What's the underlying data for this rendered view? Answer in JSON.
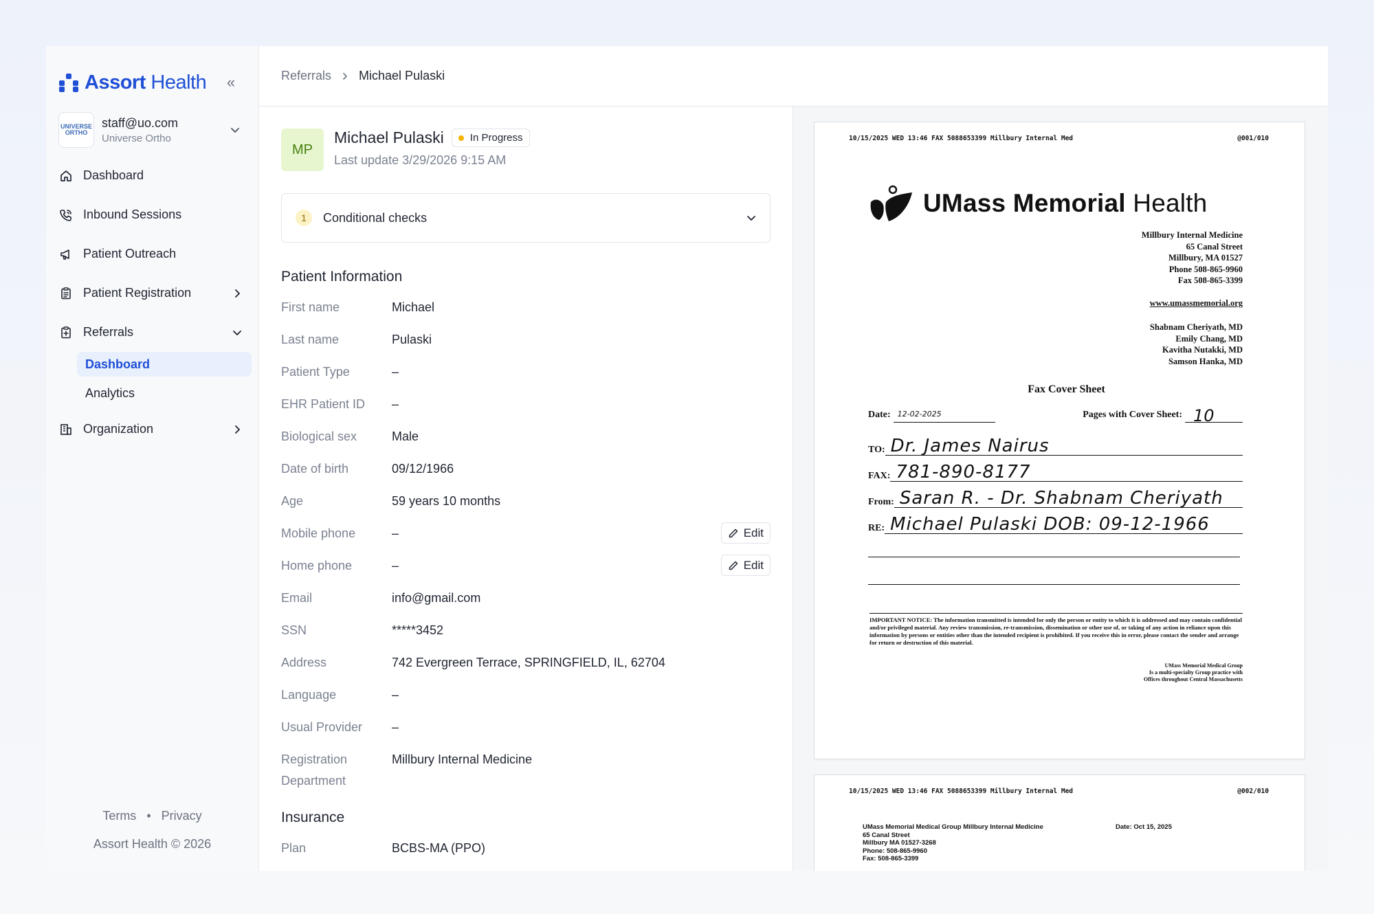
{
  "sidebar": {
    "brand_bold": "Assort",
    "brand_light": " Health",
    "collapse_glyph": "«",
    "account": {
      "logo_text": "UNIVERSE ORTHO",
      "email": "staff@uo.com",
      "org": "Universe Ortho"
    },
    "nav": [
      {
        "label": "Dashboard",
        "icon": "home-icon"
      },
      {
        "label": "Inbound Sessions",
        "icon": "phone-icon"
      },
      {
        "label": "Patient Outreach",
        "icon": "megaphone-icon"
      },
      {
        "label": "Patient Registration",
        "icon": "clipboard-icon"
      },
      {
        "label": "Referrals",
        "icon": "clipboard-plus-icon"
      },
      {
        "label": "Organization",
        "icon": "building-icon"
      }
    ],
    "referrals_sub": [
      {
        "label": "Dashboard",
        "active": true
      },
      {
        "label": "Analytics",
        "active": false
      }
    ],
    "footer": {
      "terms": "Terms",
      "dot": "•",
      "privacy": "Privacy",
      "copyright": "Assort Health © 2026"
    }
  },
  "breadcrumb": {
    "parent": "Referrals",
    "separator": "›",
    "current": "Michael Pulaski"
  },
  "patient": {
    "initials": "MP",
    "name": "Michael Pulaski",
    "status": "In Progress",
    "status_color": "#f4b400",
    "last_update": "Last update 3/29/2026 9:15 AM"
  },
  "conditional_checks": {
    "count": "1",
    "label": "Conditional checks"
  },
  "patient_info": {
    "title": "Patient Information",
    "fields": [
      {
        "label": "First name",
        "value": "Michael"
      },
      {
        "label": "Last name",
        "value": "Pulaski"
      },
      {
        "label": "Patient Type",
        "value": "–"
      },
      {
        "label": "EHR Patient ID",
        "value": "–"
      },
      {
        "label": "Biological sex",
        "value": "Male"
      },
      {
        "label": "Date of birth",
        "value": "09/12/1966"
      },
      {
        "label": "Age",
        "value": "59 years 10 months"
      },
      {
        "label": "Mobile phone",
        "value": "–"
      },
      {
        "label": "Home phone",
        "value": "–"
      },
      {
        "label": "Email",
        "value": "info@gmail.com"
      },
      {
        "label": "SSN",
        "value": "*****3452"
      },
      {
        "label": "Address",
        "value": "742 Evergreen Terrace, SPRINGFIELD, IL, 62704"
      },
      {
        "label": "Language",
        "value": "–"
      },
      {
        "label": "Usual Provider",
        "value": "–"
      },
      {
        "label": "Registration Department",
        "value": "Millbury Internal Medicine"
      }
    ],
    "edit_label": "Edit"
  },
  "insurance": {
    "title": "Insurance",
    "fields": [
      {
        "label": "Plan",
        "value": "BCBS-MA (PPO)"
      }
    ]
  },
  "fax": {
    "page1": {
      "header_left": "10/15/2025 WED 13:46  FAX 5088653399 Millbury Internal Med",
      "header_right": "@001/010",
      "brand_bold": "UMass Memorial",
      "brand_light": " Health",
      "address": [
        "Millbury Internal Medicine",
        "65 Canal Street",
        "Millbury, MA 01527",
        "Phone 508-865-9960",
        "Fax 508-865-3399"
      ],
      "website": "www.umassmemorial.org",
      "doctors": [
        "Shabnam Cheriyath, MD",
        "Emily Chang, MD",
        "Kavitha Nutakki, MD",
        "Samson Hanka, MD"
      ],
      "title": "Fax Cover Sheet",
      "date_label": "Date:",
      "date_value": "12-02-2025",
      "pages_label": "Pages with Cover Sheet:",
      "pages_value": "10",
      "to_label": "TO:",
      "to_value": "Dr. James Nairus",
      "fax_label": "FAX:",
      "fax_value": "781-890-8177",
      "from_label": "From:",
      "from_value": "Saran R. - Dr. Shabnam Cheriyath",
      "re_label": "RE:",
      "re_value": "Michael Pulaski   DOB: 09-12-1966",
      "notice": "IMPORTANT NOTICE: The information transmitted is intended for only the person or entity to which it is addressed and may contain confidential and/or privileged material. Any review transmission, re-transmission, dissemination or other use of, or taking of any action in reliance upon this information by persons or entities other than the intended recipient is prohibited. If you receive this in error, please contact the sender and arrange for return or destruction of this material.",
      "group_note": [
        "UMass Memorial Medical Group",
        "Is a multi-specialty Group practice with",
        "Offices throughout Central Massachusetts"
      ]
    },
    "page2": {
      "header_left": "10/15/2025 WED 13:46  FAX 5088653399 Millbury Internal Med",
      "header_right": "@002/010",
      "lines": [
        "UMass Memorial Medical Group Millbury Internal Medicine",
        "65 Canal Street",
        "Millbury MA 01527-3268",
        "Phone: 508-865-9960",
        "Fax: 508-865-3399"
      ],
      "date": "Date: Oct 15, 2025"
    }
  }
}
